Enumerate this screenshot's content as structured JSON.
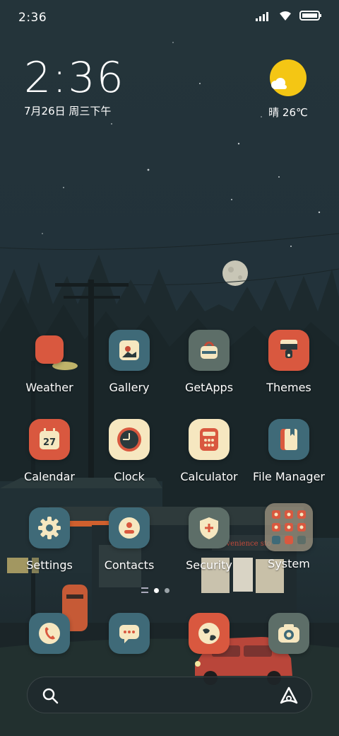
{
  "status_bar": {
    "time": "2:36"
  },
  "clock_widget": {
    "time": "2:36",
    "date": "7月26日 周三下午"
  },
  "weather_widget": {
    "text": "晴 26℃",
    "icon": "sunny-partly-cloudy-icon"
  },
  "apps": [
    {
      "label": "Weather",
      "icon": "weather-icon",
      "color": "#d9583f"
    },
    {
      "label": "Gallery",
      "icon": "gallery-icon",
      "color": "#3f6a78"
    },
    {
      "label": "GetApps",
      "icon": "getapps-bag-icon",
      "color": "#5d6e68"
    },
    {
      "label": "Themes",
      "icon": "themes-brush-icon",
      "color": "#d9583f"
    },
    {
      "label": "Calendar",
      "icon": "calendar-icon",
      "color": "#d9583f",
      "badge": "27"
    },
    {
      "label": "Clock",
      "icon": "clock-icon",
      "color": "#f6e7c0"
    },
    {
      "label": "Calculator",
      "icon": "calculator-icon",
      "color": "#f6e7c0"
    },
    {
      "label": "File Manager",
      "icon": "folder-book-icon",
      "color": "#3f6a78"
    },
    {
      "label": "Settings",
      "icon": "gear-icon",
      "color": "#3f6a78"
    },
    {
      "label": "Contacts",
      "icon": "contact-person-icon",
      "color": "#3f6a78"
    },
    {
      "label": "Security",
      "icon": "shield-icon",
      "color": "#5d6e68"
    },
    {
      "label": "System",
      "icon": "folder-icon",
      "color": "#8a8f86"
    }
  ],
  "dock": [
    {
      "name": "phone",
      "icon": "phone-icon",
      "color": "#3f6a78"
    },
    {
      "name": "messages",
      "icon": "message-bubble-icon",
      "color": "#3f6a78"
    },
    {
      "name": "browser",
      "icon": "globe-icon",
      "color": "#d9583f"
    },
    {
      "name": "camera",
      "icon": "camera-icon",
      "color": "#5d6e68"
    }
  ],
  "page_indicator": {
    "pages": 2,
    "current": 1
  },
  "search_bar": {
    "left_icon": "search-icon",
    "right_icon": "assistant-icon"
  }
}
